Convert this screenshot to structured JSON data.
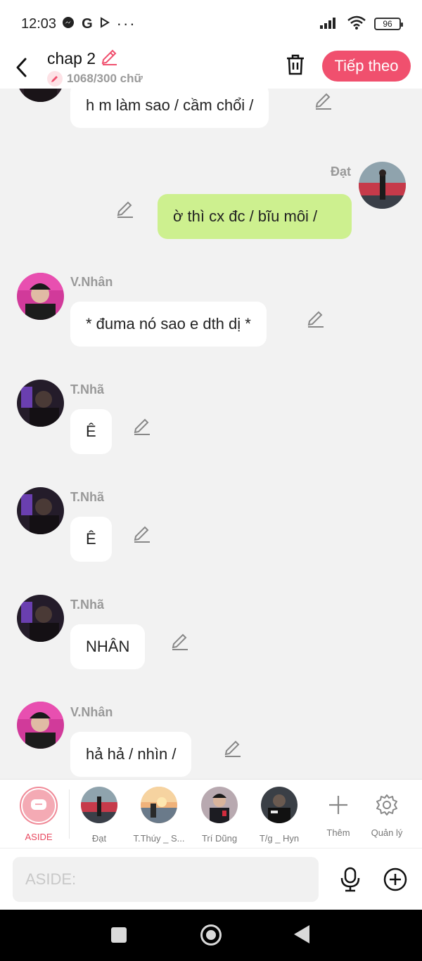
{
  "status": {
    "time": "12:03",
    "battery": "96"
  },
  "header": {
    "title": "chap 2",
    "counter": "1068/300 chữ",
    "next_label": "Tiếp theo"
  },
  "messages": [
    {
      "sender": "",
      "text": "h m làm sao / cầm chổi /"
    },
    {
      "sender": "Đạt",
      "text": "ờ thì cx đc / bĩu môi /"
    },
    {
      "sender": "V.Nhân",
      "text": "* đuma nó sao e dth dị *"
    },
    {
      "sender": "T.Nhã",
      "text": "Ê"
    },
    {
      "sender": "T.Nhã",
      "text": "Ê"
    },
    {
      "sender": "T.Nhã",
      "text": "NHÂN"
    },
    {
      "sender": "V.Nhân",
      "text": "hả hả / nhìn /"
    }
  ],
  "characters": {
    "aside": "ASIDE",
    "items": [
      "Đạt",
      "T.Thúy _ S...",
      "Trí Dũng",
      "T/g _ Hyn"
    ],
    "add": "Thêm",
    "manage": "Quản lý"
  },
  "input": {
    "placeholder": "ASIDE:"
  },
  "colors": {
    "accent": "#f0506e",
    "my_bubble": "#cdf08f",
    "background": "#f2f2f2"
  }
}
